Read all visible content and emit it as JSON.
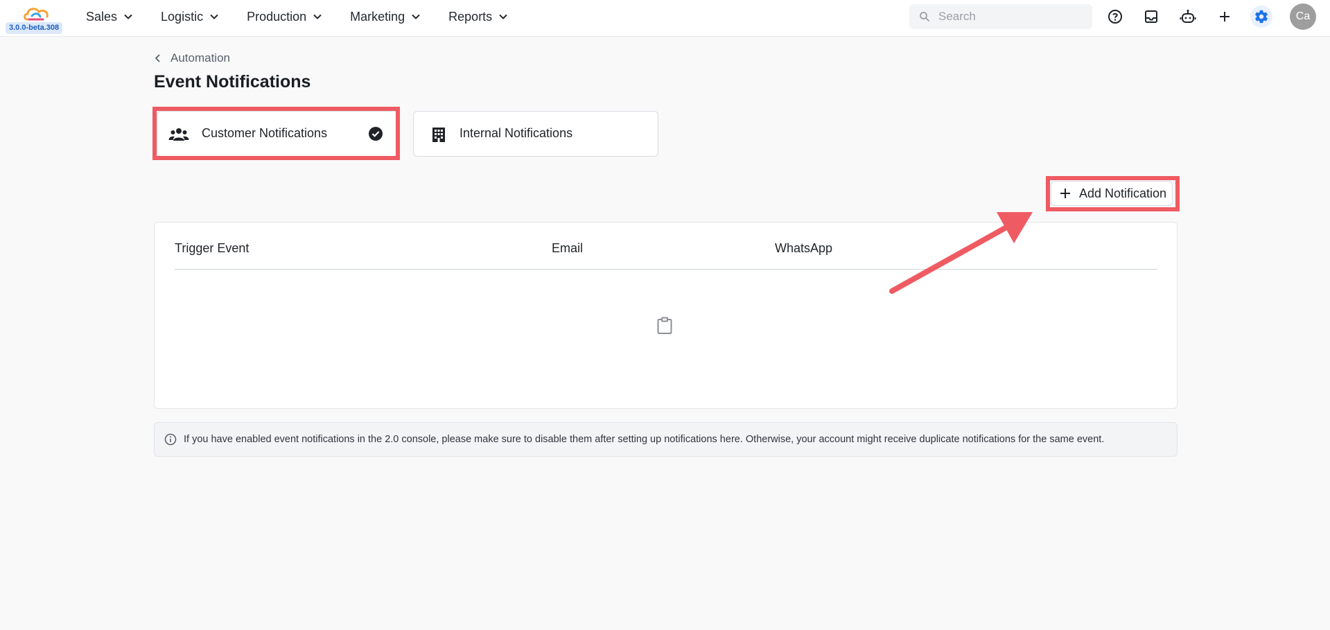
{
  "app": {
    "version": "3.0.0-beta.308"
  },
  "nav": {
    "items": [
      {
        "label": "Sales"
      },
      {
        "label": "Logistic"
      },
      {
        "label": "Production"
      },
      {
        "label": "Marketing"
      },
      {
        "label": "Reports"
      }
    ]
  },
  "search": {
    "placeholder": "Search"
  },
  "user": {
    "initials": "Ca"
  },
  "breadcrumb": {
    "label": "Automation"
  },
  "page": {
    "title": "Event Notifications"
  },
  "notification_types": [
    {
      "label": "Customer Notifications",
      "icon": "people-icon",
      "selected": true
    },
    {
      "label": "Internal Notifications",
      "icon": "building-icon",
      "selected": false
    }
  ],
  "actions": {
    "add_label": "Add Notification"
  },
  "table": {
    "columns": [
      "Trigger Event",
      "Email",
      "WhatsApp"
    ],
    "rows": []
  },
  "info": {
    "text": "If you have enabled event notifications in the 2.0 console, please make sure to disable them after setting up notifications here. Otherwise, your account might receive duplicate notifications for the same event."
  },
  "colors": {
    "highlight": "#ef5b62",
    "accent": "#1a73e8",
    "version_badge_bg": "#dce9fb"
  }
}
